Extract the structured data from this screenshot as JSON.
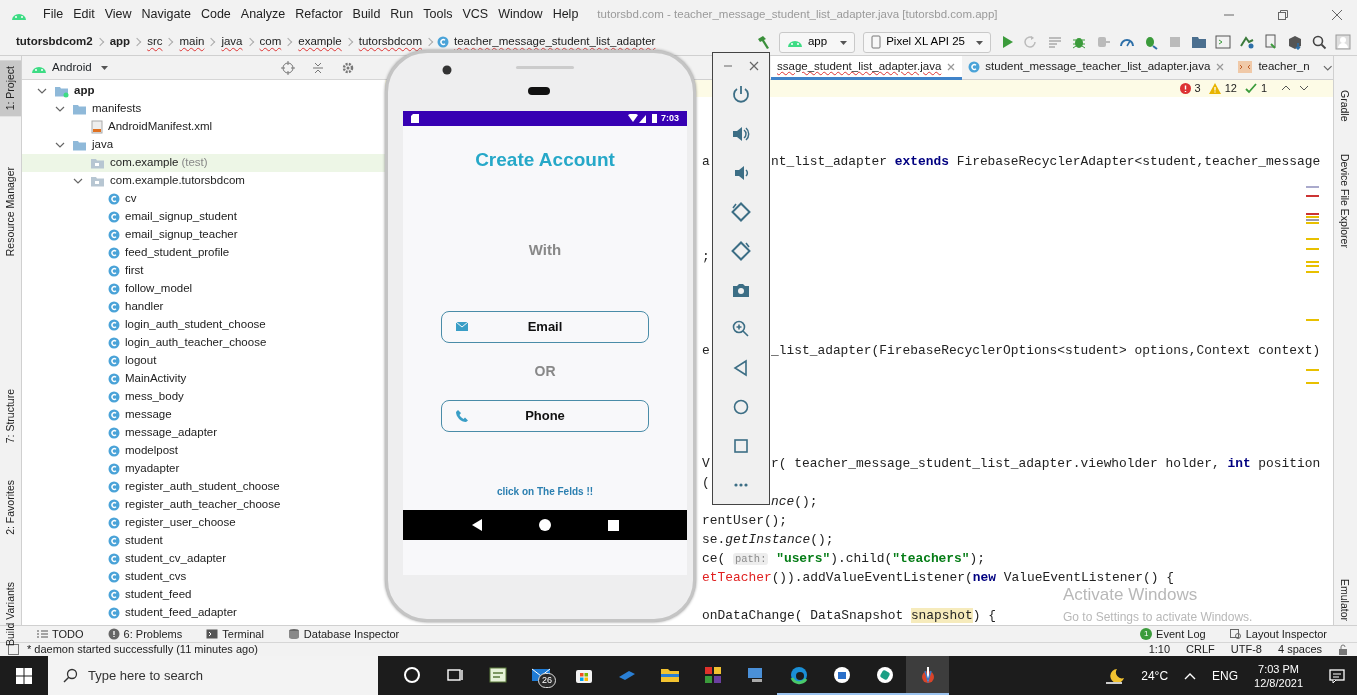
{
  "title_bar": {
    "menus": [
      "File",
      "Edit",
      "View",
      "Navigate",
      "Code",
      "Analyze",
      "Refactor",
      "Build",
      "Run",
      "Tools",
      "VCS",
      "Window",
      "Help"
    ],
    "title": "tutorsbd.com - teacher_message_student_list_adapter.java [tutorsbd.com.app]"
  },
  "navigation_bar": {
    "breadcrumbs": [
      {
        "label": "tutorsbdcom2",
        "kind": "project"
      },
      {
        "label": "app",
        "kind": "module"
      },
      {
        "label": "src",
        "kind": "folder"
      },
      {
        "label": "main",
        "kind": "folder"
      },
      {
        "label": "java",
        "kind": "folder"
      },
      {
        "label": "com",
        "kind": "folder"
      },
      {
        "label": "example",
        "kind": "folder"
      },
      {
        "label": "tutorsbdcom",
        "kind": "folder"
      },
      {
        "label": "teacher_message_student_list_adapter",
        "kind": "class"
      }
    ],
    "run_config": "app",
    "device": "Pixel XL API 25"
  },
  "left_tool_strip": [
    {
      "label": "1: Project",
      "selected": true
    },
    {
      "label": "Resource Manager",
      "selected": false
    },
    {
      "label": "7: Structure",
      "selected": false
    },
    {
      "label": "2: Favorites",
      "selected": false
    },
    {
      "label": "Build Variants",
      "selected": false
    }
  ],
  "project_panel": {
    "view": "Android",
    "tree": [
      {
        "label": "app",
        "kind": "module",
        "expanded": true,
        "selected": false,
        "children": [
          {
            "label": "manifests",
            "kind": "folder",
            "expanded": true,
            "selected": false,
            "children": [
              {
                "label": "AndroidManifest.xml",
                "kind": "manifest",
                "selected": false
              }
            ]
          },
          {
            "label": "java",
            "kind": "folder",
            "expanded": true,
            "selected": false,
            "children": [
              {
                "label": "com.example",
                "note": "(test)",
                "kind": "package",
                "selected": true
              },
              {
                "label": "com.example.tutorsbdcom",
                "kind": "package",
                "expanded": true,
                "selected": false,
                "children": [
                  {
                    "label": "cv",
                    "kind": "class",
                    "selected": false
                  },
                  {
                    "label": "email_signup_student",
                    "kind": "class",
                    "selected": false
                  },
                  {
                    "label": "email_signup_teacher",
                    "kind": "class",
                    "selected": false
                  },
                  {
                    "label": "feed_student_profile",
                    "kind": "class",
                    "selected": false
                  },
                  {
                    "label": "first",
                    "kind": "class",
                    "selected": false
                  },
                  {
                    "label": "follow_model",
                    "kind": "class",
                    "selected": false
                  },
                  {
                    "label": "handler",
                    "kind": "class",
                    "selected": false
                  },
                  {
                    "label": "login_auth_student_choose",
                    "kind": "class",
                    "selected": false
                  },
                  {
                    "label": "login_auth_teacher_choose",
                    "kind": "class",
                    "selected": false
                  },
                  {
                    "label": "logout",
                    "kind": "class",
                    "selected": false
                  },
                  {
                    "label": "MainActivity",
                    "kind": "class",
                    "selected": false
                  },
                  {
                    "label": "mess_body",
                    "kind": "class",
                    "selected": false
                  },
                  {
                    "label": "message",
                    "kind": "class",
                    "selected": false
                  },
                  {
                    "label": "message_adapter",
                    "kind": "class",
                    "selected": false
                  },
                  {
                    "label": "modelpost",
                    "kind": "class",
                    "selected": false
                  },
                  {
                    "label": "myadapter",
                    "kind": "class",
                    "selected": false
                  },
                  {
                    "label": "register_auth_student_choose",
                    "kind": "class",
                    "selected": false
                  },
                  {
                    "label": "register_auth_teacher_choose",
                    "kind": "class",
                    "selected": false
                  },
                  {
                    "label": "register_user_choose",
                    "kind": "class",
                    "selected": false
                  },
                  {
                    "label": "student",
                    "kind": "class",
                    "selected": false
                  },
                  {
                    "label": "student_cv_adapter",
                    "kind": "class",
                    "selected": false
                  },
                  {
                    "label": "student_cvs",
                    "kind": "class",
                    "selected": false
                  },
                  {
                    "label": "student_feed",
                    "kind": "class",
                    "selected": false
                  },
                  {
                    "label": "student_feed_adapter",
                    "kind": "class",
                    "selected": false
                  }
                ]
              }
            ]
          }
        ]
      }
    ]
  },
  "editor": {
    "tabs": [
      {
        "label": "ssage_student_list_adapter.java",
        "kind": "class",
        "selected": true,
        "closable": true
      },
      {
        "label": "student_message_teacher_list_adapter.java",
        "kind": "class",
        "selected": false,
        "closable": true
      },
      {
        "label": "teacher_n",
        "kind": "layout",
        "selected": false,
        "closable": false
      }
    ],
    "problems": {
      "errors": "3",
      "warnings": "12",
      "weak_warnings": "1"
    },
    "lines": [
      {
        "kind": "blank"
      },
      {
        "kind": "blank"
      },
      {
        "kind": "blank"
      },
      {
        "kind": "split",
        "left": "a",
        "tokens": [
          {
            "kind": "plain",
            "text": "nt_list_adapter "
          },
          {
            "kind": "keyword",
            "text": "extends"
          },
          {
            "kind": "plain",
            "text": " FirebaseRecyclerAdapter<student,teacher_message"
          }
        ]
      },
      {
        "kind": "blank"
      },
      {
        "kind": "blank"
      },
      {
        "kind": "blank"
      },
      {
        "kind": "blank"
      },
      {
        "kind": "split",
        "left": ";"
      },
      {
        "kind": "blank"
      },
      {
        "kind": "blank"
      },
      {
        "kind": "blank"
      },
      {
        "kind": "blank"
      },
      {
        "kind": "split",
        "left": "e",
        "tokens": [
          {
            "kind": "plain",
            "text": "_list_adapter(FirebaseRecyclerOptions<student> options,Context context)"
          }
        ]
      },
      {
        "kind": "blank"
      },
      {
        "kind": "blank"
      },
      {
        "kind": "blank"
      },
      {
        "kind": "blank"
      },
      {
        "kind": "blank"
      },
      {
        "kind": "split",
        "left": "V",
        "tokens": [
          {
            "kind": "plain",
            "text": "r( teacher_message_student_list_adapter.viewholder holder, "
          },
          {
            "kind": "keyword",
            "text": "int"
          },
          {
            "kind": "plain",
            "text": " position"
          }
        ]
      },
      {
        "kind": "split",
        "left": "("
      },
      {
        "kind": "split",
        "tokens": [
          {
            "kind": "italic",
            "text": "nce"
          },
          {
            "kind": "plain",
            "text": "();"
          }
        ]
      },
      {
        "kind": "code",
        "tokens": [
          {
            "kind": "plain",
            "text": "rentUser();"
          }
        ]
      },
      {
        "kind": "code",
        "tokens": [
          {
            "kind": "plain",
            "text": "se."
          },
          {
            "kind": "italic",
            "text": "getInstance"
          },
          {
            "kind": "plain",
            "text": "();"
          }
        ]
      },
      {
        "kind": "code",
        "tokens": [
          {
            "kind": "plain",
            "text": "ce( "
          },
          {
            "kind": "hint",
            "text": "path:"
          },
          {
            "kind": "string",
            "text": "\"users\""
          },
          {
            "kind": "plain",
            "text": ").child("
          },
          {
            "kind": "string",
            "text": "\"teachers\""
          },
          {
            "kind": "plain",
            "text": ");"
          }
        ]
      },
      {
        "kind": "code",
        "tokens": [
          {
            "kind": "error",
            "text": "etTeacher"
          },
          {
            "kind": "plain",
            "text": "()).addValueEventListener("
          },
          {
            "kind": "keyword",
            "text": "new"
          },
          {
            "kind": "plain",
            "text": " ValueEventListener() {"
          }
        ]
      },
      {
        "kind": "blank"
      },
      {
        "kind": "code",
        "tokens": [
          {
            "kind": "plain",
            "text": "onDataChange( DataSnapshot "
          },
          {
            "kind": "highlight",
            "text": "snapshot"
          },
          {
            "kind": "plain",
            "text": ") {"
          }
        ]
      }
    ]
  },
  "right_tool_strip": [
    "Gradle",
    "Device File Explorer",
    "Emulator"
  ],
  "emulator": {
    "status_time": "7:03",
    "title": "Create Account",
    "subtitle": "With",
    "buttons": [
      {
        "label": "Email",
        "kind": "email"
      },
      {
        "label": "Phone",
        "kind": "phone"
      }
    ],
    "separator": "OR",
    "hint": "click on The Felds !!"
  },
  "os_notice": {
    "title": "Activate Windows",
    "text": "Go to Settings to activate Windows."
  },
  "bottom_tool_bar": {
    "left": [
      {
        "label": "TODO",
        "kind": "todo"
      },
      {
        "label": "6: Problems",
        "kind": "problems"
      },
      {
        "label": "Terminal",
        "kind": "terminal"
      },
      {
        "label": "Database Inspector",
        "kind": "database"
      }
    ],
    "right": [
      {
        "label": "Event Log",
        "kind": "event",
        "badge": "1"
      },
      {
        "label": "Layout Inspector",
        "kind": "layout"
      }
    ]
  },
  "status_bar": {
    "message": "* daemon started successfully (11 minutes ago)",
    "items": [
      "1:10",
      "CRLF",
      "UTF-8",
      "4 spaces"
    ]
  },
  "taskbar": {
    "search_placeholder": "Type here to search",
    "apps": [
      {
        "kind": "cortana",
        "running": false,
        "selected": false
      },
      {
        "kind": "taskview",
        "running": false,
        "selected": false
      },
      {
        "kind": "notes",
        "running": false,
        "selected": false
      },
      {
        "kind": "mail",
        "running": false,
        "selected": false,
        "badge": "26"
      },
      {
        "kind": "store",
        "running": false,
        "selected": false
      },
      {
        "kind": "arrow",
        "running": false,
        "selected": false
      },
      {
        "kind": "files",
        "running": false,
        "selected": false
      },
      {
        "kind": "tiles",
        "running": false,
        "selected": false
      },
      {
        "kind": "computer",
        "running": false,
        "selected": false
      },
      {
        "kind": "edge",
        "running": true,
        "selected": false
      },
      {
        "kind": "bluecircle",
        "running": true,
        "selected": false
      },
      {
        "kind": "greencircle",
        "running": true,
        "selected": false
      },
      {
        "kind": "studio",
        "running": true,
        "selected": true
      }
    ],
    "temperature": "24°C",
    "language": "ENG",
    "time": "7:03 PM",
    "date": "12/8/2021"
  }
}
